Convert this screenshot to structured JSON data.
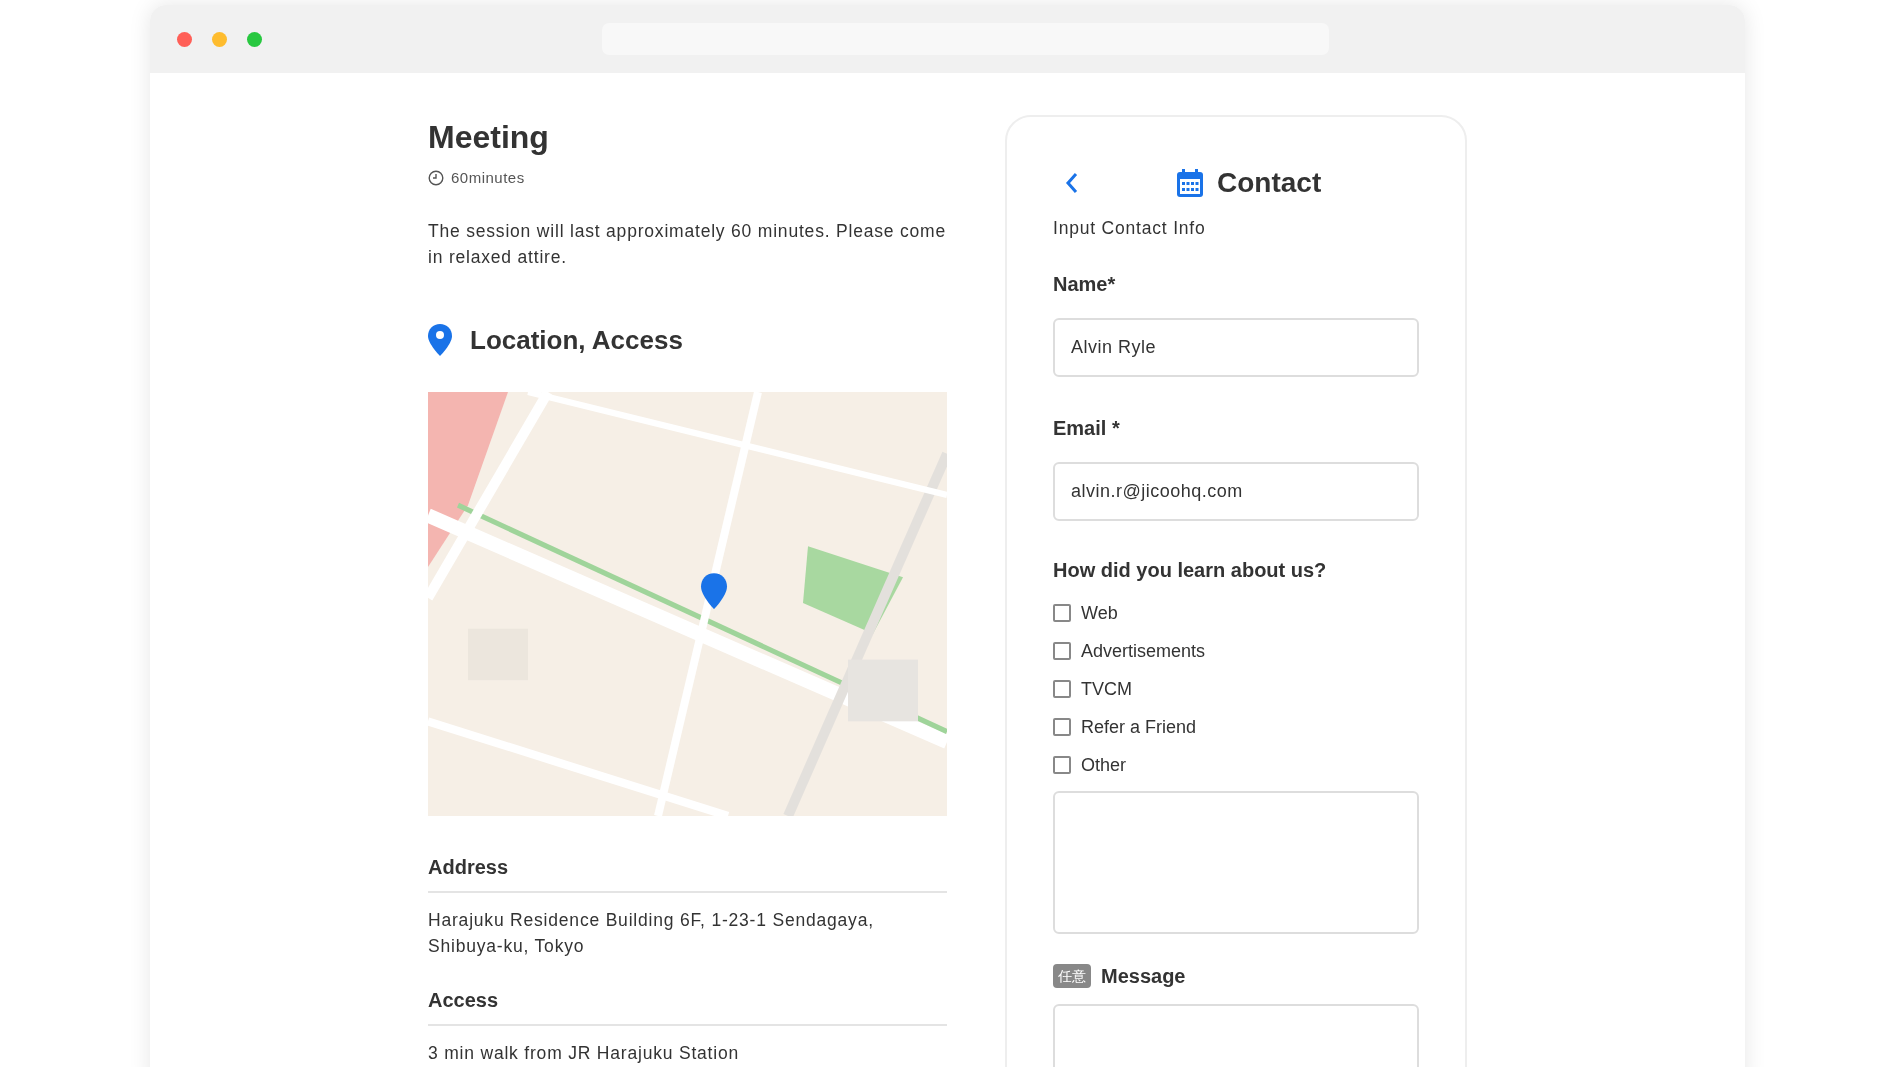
{
  "event": {
    "title": "Meeting",
    "duration": "60minutes",
    "description": "The session will last approximately 60 minutes. Please come in relaxed attire.",
    "location_heading": "Location, Access",
    "sections": [
      {
        "heading": "Address",
        "body": "Harajuku Residence Building 6F, 1-23-1 Sendagaya, Shibuya-ku, Tokyo"
      },
      {
        "heading": "Access",
        "body": "3 min walk from JR Harajuku Station"
      }
    ]
  },
  "contact": {
    "title": "Contact",
    "subtitle": "Input Contact Info",
    "fields": [
      {
        "label": "Name*",
        "value": "Alvin Ryle"
      },
      {
        "label": "Email *",
        "value": "alvin.r@jicoohq.com"
      }
    ],
    "question": {
      "label": "How did you learn about us?",
      "options": [
        {
          "label": "Web",
          "checked": false
        },
        {
          "label": "Advertisements",
          "checked": false
        },
        {
          "label": "TVCM",
          "checked": false
        },
        {
          "label": "Refer a Friend",
          "checked": false
        },
        {
          "label": "Other",
          "checked": false
        }
      ]
    },
    "message": {
      "badge": "任意",
      "label": "Message"
    }
  }
}
